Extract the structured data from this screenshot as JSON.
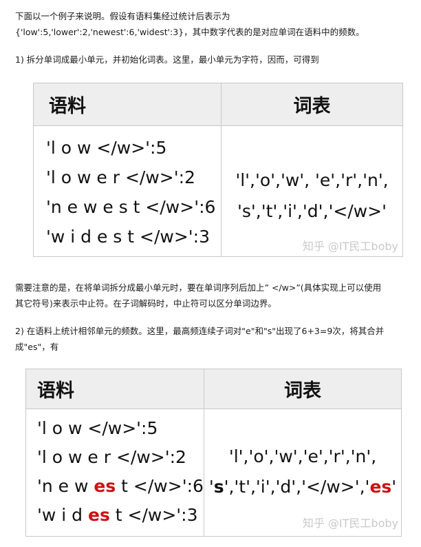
{
  "intro": {
    "line1": "下面以一个例子来说明。假设有语料集经过统计后表示为",
    "line2": "{'low':5,'lower':2,'newest':6,'widest':3}，其中数字代表的是对应单词在语料中的频数。"
  },
  "step1": {
    "text": "1) 拆分单词成最小单元，并初始化词表。这里，最小单元为字符，因而，可得到"
  },
  "table1": {
    "header_corpus": "语料",
    "header_vocab": "词表",
    "corpus_rows": [
      "'l o w </w>':5",
      "'l o w e r </w>':2",
      "'n e w e s t </w>':6",
      "'w i d e s t </w>':3"
    ],
    "vocab_rows": [
      "'l','o','w', 'e','r','n',",
      "'s','t','i','d','</w>'"
    ],
    "watermark": "知乎 @IT民工boby"
  },
  "note": {
    "line1": "需要注意的是，在将单词拆分成最小单元时，要在单词序列后加上” </w>”(具体实现上可以使用",
    "line2": "其它符号)来表示中止符。在子词解码时，中止符可以区分单词边界。"
  },
  "step2": {
    "line1": "2) 在语料上统计相邻单元的频数。这里，最高频连续子词对\"e\"和\"s\"出现了6+3=9次，将其合并",
    "line2": "成\"es\"，有"
  },
  "table2": {
    "header_corpus": "语料",
    "header_vocab": "词表",
    "corpus_rows": [
      {
        "pre": "'l o w </w>':5",
        "hl": "",
        "post": ""
      },
      {
        "pre": "'l o w e r </w>':2",
        "hl": "",
        "post": ""
      },
      {
        "pre": "'n e w ",
        "hl": "es",
        "post": " t </w>':6"
      },
      {
        "pre": "'w i d ",
        "hl": "es",
        "post": " t </w>':3"
      }
    ],
    "vocab_row1": "'l','o','w','e','r','n',",
    "vocab_row2": {
      "q1": "'",
      "bold_s": "s",
      "mid": "','t','i','d','</w>','",
      "hl": "es",
      "q2": "'"
    },
    "watermark": "知乎 @IT民工boby"
  },
  "colors": {
    "highlight": "#cc1111",
    "header_bg": "#eeeeee",
    "border": "#c8c8c8",
    "watermark": "#c9c9c9"
  }
}
